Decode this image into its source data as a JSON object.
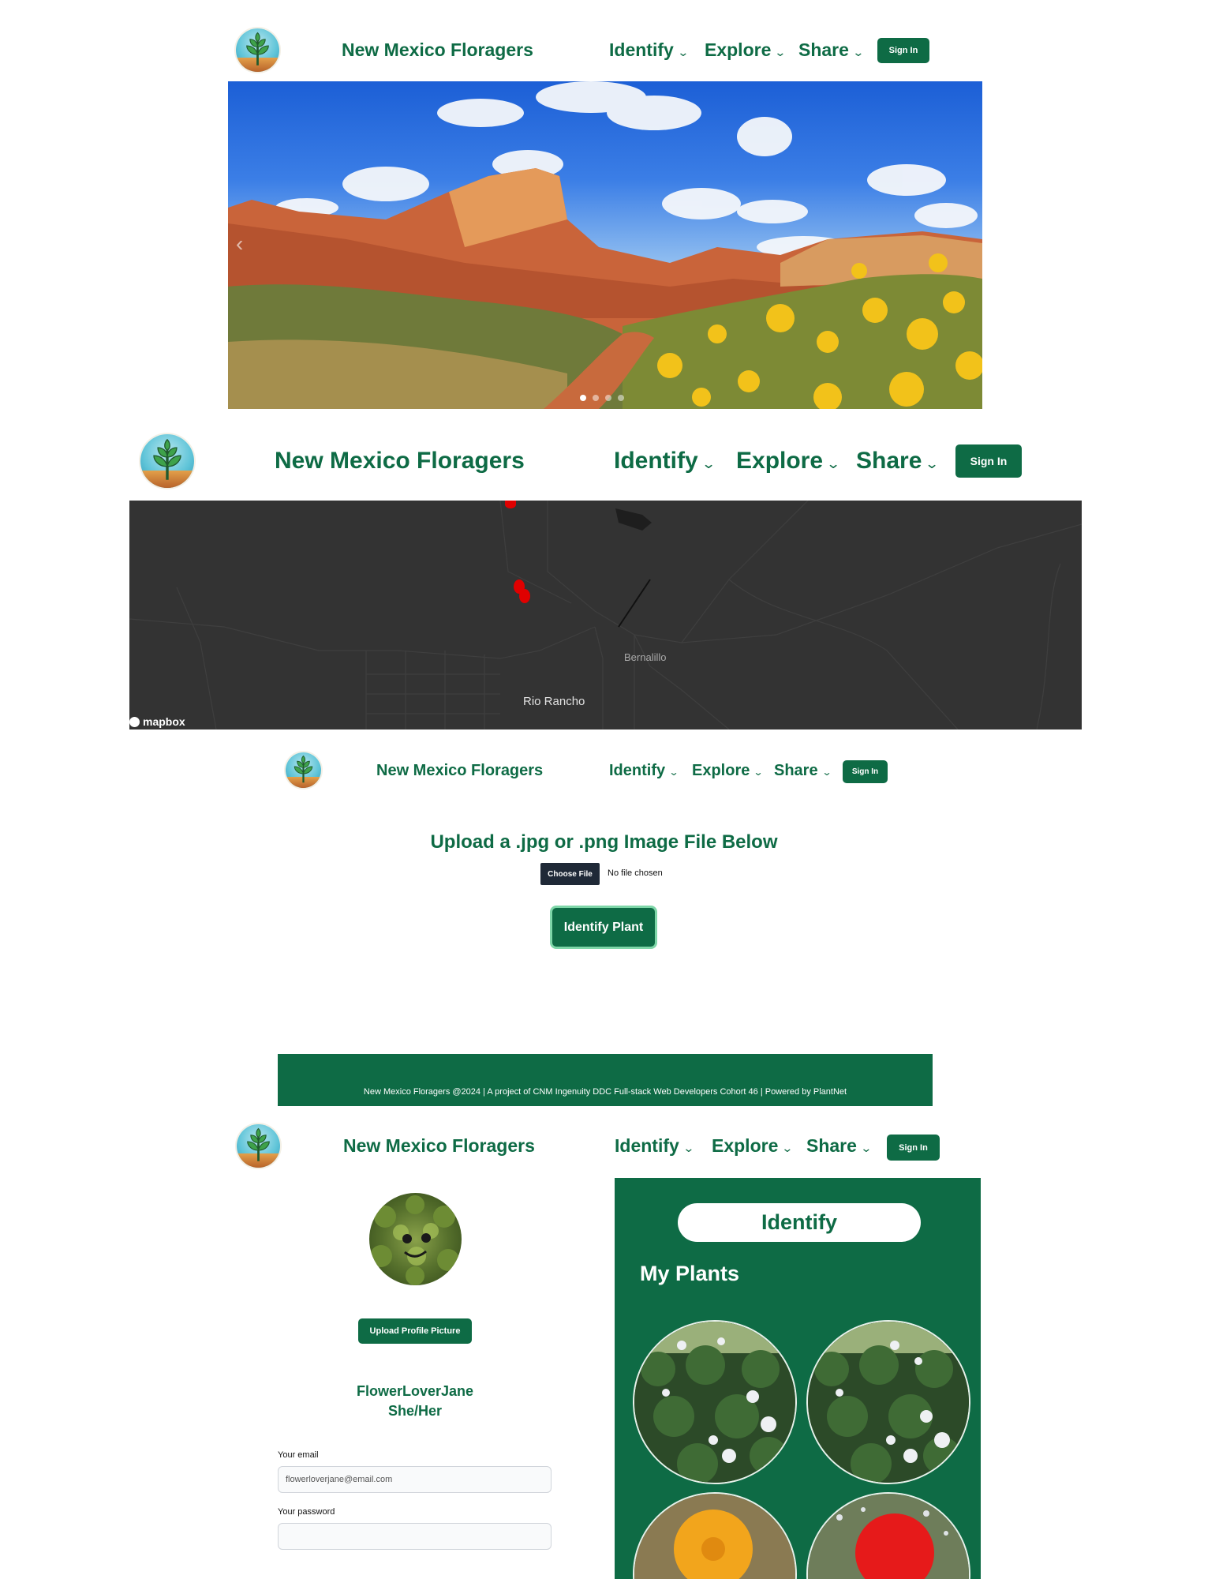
{
  "header": {
    "brand": "New Mexico Floragers",
    "nav": {
      "identify": "Identify",
      "explore": "Explore",
      "share": "Share",
      "chevron": "⌄"
    },
    "sign_in": "Sign In",
    "logo_icon": "tree-sapling-icon"
  },
  "hero": {
    "carousel_dots": 4,
    "active_dot": 1,
    "prev_icon": "chevron-left-icon",
    "prev_glyph": "‹"
  },
  "map": {
    "places": [
      "Bernalillo",
      "Rio Rancho"
    ],
    "attribution": "mapbox",
    "marker_color": "#e00000"
  },
  "upload": {
    "heading": "Upload a .jpg or .png Image File Below",
    "choose_file": "Choose File",
    "no_file": "No file chosen",
    "identify_button": "Identify Plant"
  },
  "footer": {
    "text": "New Mexico Floragers @2024 | A project of CNM Ingenuity DDC Full-stack Web Developers Cohort 46 | Powered by PlantNet"
  },
  "profile": {
    "upload_button": "Upload Profile Picture",
    "username": "FlowerLoverJane",
    "pronouns": "She/Her",
    "email_label": "Your email",
    "email_value": "flowerloverjane@email.com",
    "password_label": "Your password",
    "password_value": ""
  },
  "panel": {
    "identify": "Identify",
    "my_plants": "My Plants"
  },
  "colors": {
    "brand_green": "#0e6b45",
    "map_bg": "#333333",
    "choose_file_bg": "#1f2937"
  }
}
